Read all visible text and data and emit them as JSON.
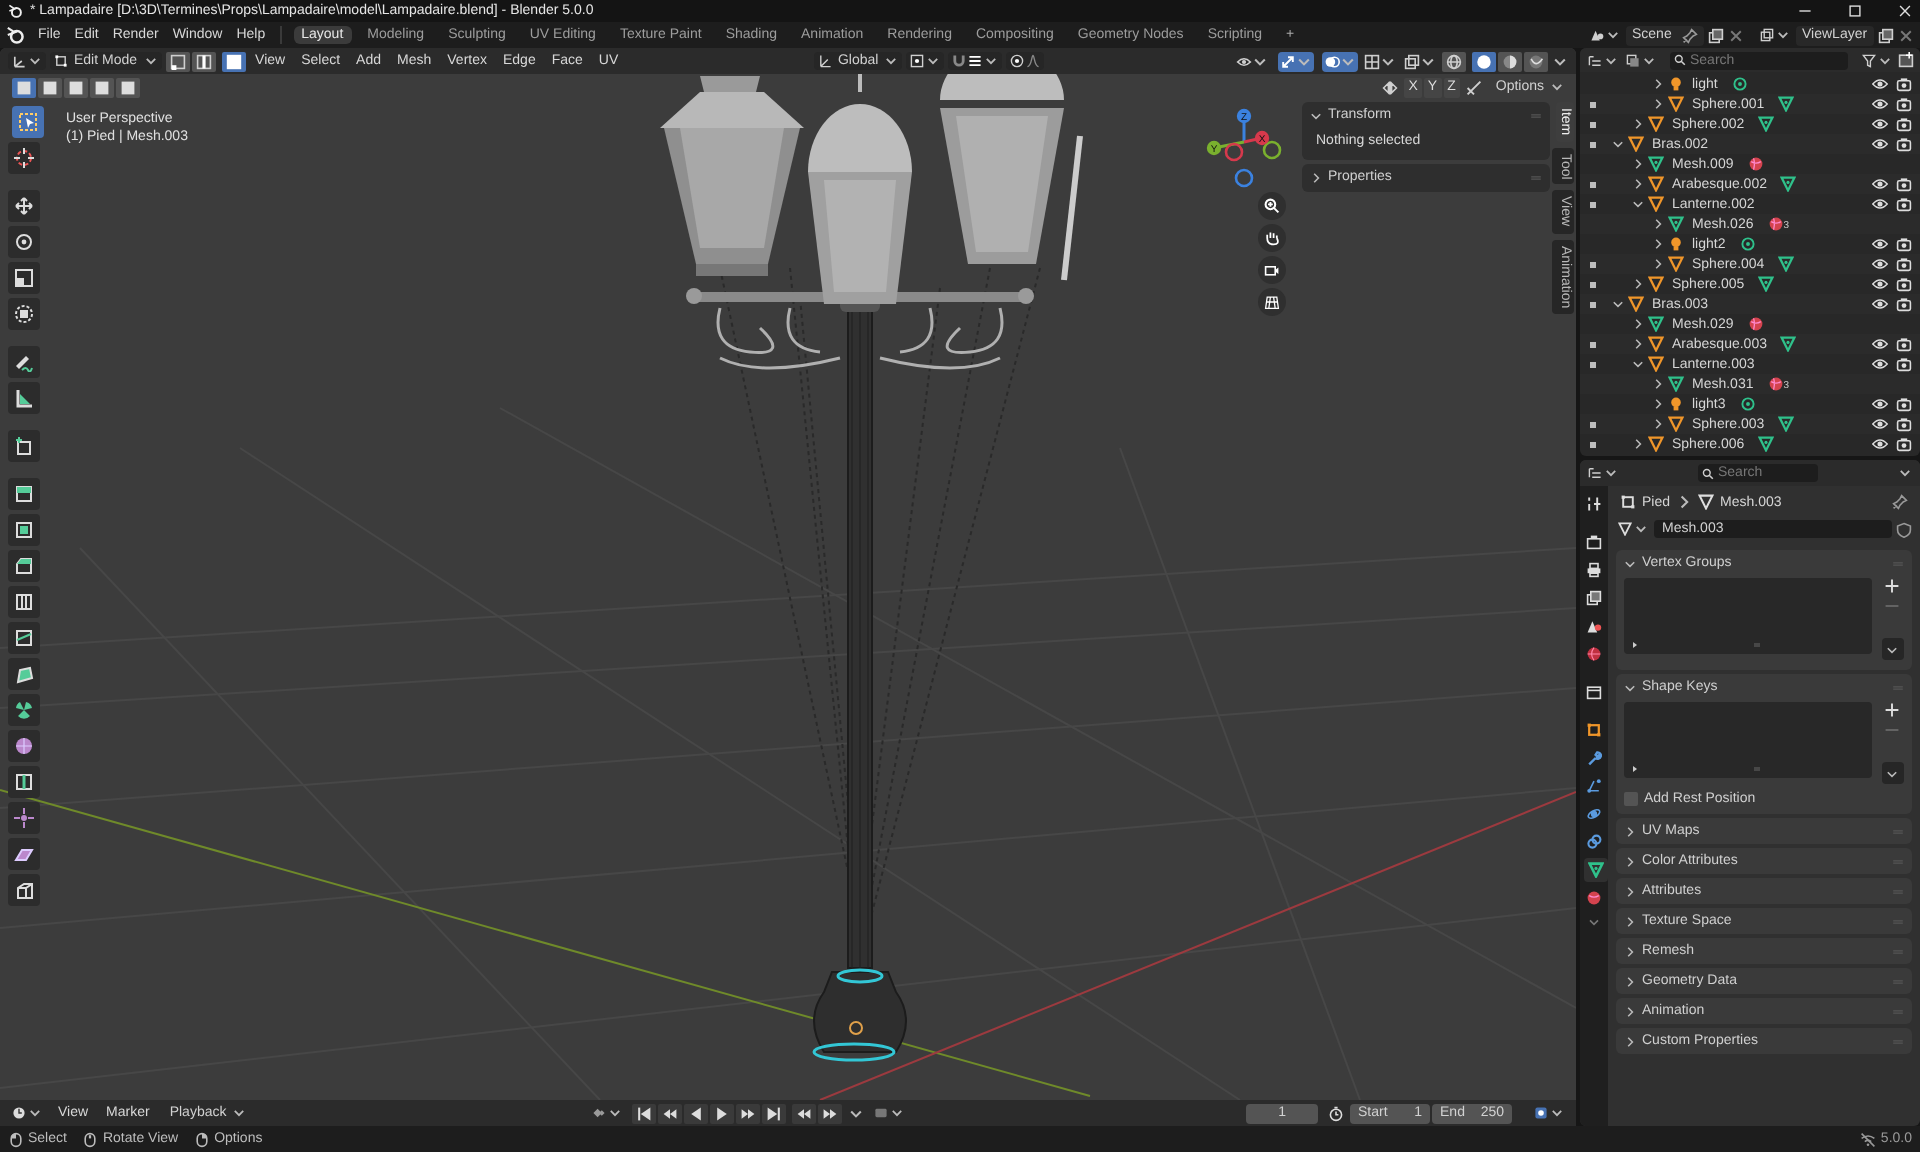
{
  "window": {
    "title": "* Lampadaire [D:\\3D\\Termines\\Props\\Lampadaire\\model\\Lampadaire.blend] - Blender 5.0.0"
  },
  "menu": [
    "File",
    "Edit",
    "Render",
    "Window",
    "Help"
  ],
  "workspaces": [
    {
      "label": "Layout",
      "selected": true
    },
    {
      "label": "Modeling",
      "selected": false
    },
    {
      "label": "Sculpting",
      "selected": false
    },
    {
      "label": "UV Editing",
      "selected": false
    },
    {
      "label": "Texture Paint",
      "selected": false
    },
    {
      "label": "Shading",
      "selected": false
    },
    {
      "label": "Animation",
      "selected": false
    },
    {
      "label": "Rendering",
      "selected": false
    },
    {
      "label": "Compositing",
      "selected": false
    },
    {
      "label": "Geometry Nodes",
      "selected": false
    },
    {
      "label": "Scripting",
      "selected": false
    }
  ],
  "add_workspace": "+",
  "scene": "Scene",
  "view_layer": "ViewLayer",
  "viewport": {
    "mode": "Edit Mode",
    "select_modes": [
      {
        "kind": "vertex",
        "selected": false
      },
      {
        "kind": "edge",
        "selected": false
      },
      {
        "kind": "face",
        "selected": true
      }
    ],
    "menus": [
      "View",
      "Select",
      "Add",
      "Mesh",
      "Vertex",
      "Edge",
      "Face",
      "UV"
    ],
    "orientation": "Global",
    "toggles": [
      {
        "kind": "visibility",
        "on": false
      },
      {
        "kind": "gizmo",
        "on": true
      },
      {
        "kind": "overlay",
        "on": true
      },
      {
        "kind": "mesh-overlay",
        "on": false
      },
      {
        "kind": "xray",
        "on": false
      }
    ],
    "shading": [
      {
        "kind": "wireframe",
        "selected": false
      },
      {
        "kind": "solid",
        "selected": true
      },
      {
        "kind": "material",
        "selected": false
      },
      {
        "kind": "rendered",
        "selected": false
      }
    ],
    "selection_ops": [
      {
        "selected": true
      },
      {
        "selected": false
      },
      {
        "selected": false
      },
      {
        "selected": false
      },
      {
        "selected": false
      }
    ],
    "mirror_axes": [
      {
        "label": "X",
        "on": false
      },
      {
        "label": "Y",
        "on": false
      },
      {
        "label": "Z",
        "on": false
      }
    ],
    "options": "Options",
    "view_name": "User Perspective",
    "object_info": "(1) Pied | Mesh.003",
    "gizmo_axes": [
      "Z",
      "Y",
      "X"
    ],
    "tools": [
      {
        "kind": "select-box",
        "selected": true
      },
      {
        "kind": "cursor",
        "selected": false
      },
      {
        "kind": "move",
        "selected": false
      },
      {
        "kind": "rotate",
        "selected": false
      },
      {
        "kind": "scale",
        "selected": false
      },
      {
        "kind": "transform",
        "selected": false
      },
      {
        "kind": "annotate",
        "selected": false
      },
      {
        "kind": "measure",
        "selected": false
      },
      {
        "kind": "add-cube",
        "selected": false
      },
      {
        "kind": "extrude",
        "selected": false
      },
      {
        "kind": "inset",
        "selected": false
      },
      {
        "kind": "bevel",
        "selected": false
      },
      {
        "kind": "loop-cut",
        "selected": false
      },
      {
        "kind": "knife",
        "selected": false
      },
      {
        "kind": "poly-build",
        "selected": false
      },
      {
        "kind": "spin",
        "selected": false
      },
      {
        "kind": "smooth",
        "selected": false
      },
      {
        "kind": "edge-slide",
        "selected": false
      },
      {
        "kind": "shrink",
        "selected": false
      },
      {
        "kind": "shear",
        "selected": false
      },
      {
        "kind": "rip",
        "selected": false
      }
    ],
    "sidebar": {
      "tabs": [
        {
          "label": "Item",
          "selected": true
        },
        {
          "label": "Tool",
          "selected": false
        },
        {
          "label": "View",
          "selected": false
        },
        {
          "label": "Animation",
          "selected": false
        }
      ],
      "panels": [
        {
          "title": "Transform",
          "expanded": true,
          "text": "Nothing selected"
        },
        {
          "title": "Properties",
          "expanded": false
        }
      ]
    }
  },
  "outliner": {
    "search": {
      "placeholder": "Search"
    },
    "items": [
      {
        "children": [
          {
            "children": [
              {
                "name": "light",
                "kind": "light",
                "expanded": false,
                "badge": {
                  "kind": "light-data"
                }
              },
              {
                "name": "Sphere.001",
                "kind": "object",
                "expanded": false,
                "badge": {
                  "kind": "mesh"
                }
              }
            ]
          },
          {
            "name": "Sphere.002",
            "kind": "object",
            "expanded": false,
            "badge": {
              "kind": "mesh"
            }
          }
        ]
      },
      {
        "name": "Bras.002",
        "kind": "object",
        "expanded": true,
        "children": [
          {
            "name": "Mesh.009",
            "kind": "mesh",
            "expanded": false,
            "badge": {
              "kind": "material"
            }
          },
          {
            "name": "Arabesque.002",
            "kind": "object",
            "expanded": false,
            "badge": {
              "kind": "mesh"
            }
          },
          {
            "name": "Lanterne.002",
            "kind": "object",
            "expanded": true,
            "children": [
              {
                "name": "Mesh.026",
                "kind": "mesh",
                "expanded": false,
                "badge": {
                  "kind": "material",
                  "count": "3"
                }
              },
              {
                "name": "light2",
                "kind": "light",
                "expanded": false,
                "badge": {
                  "kind": "light-data"
                }
              },
              {
                "name": "Sphere.004",
                "kind": "object",
                "expanded": false,
                "badge": {
                  "kind": "mesh"
                }
              }
            ]
          },
          {
            "name": "Sphere.005",
            "kind": "object",
            "expanded": false,
            "badge": {
              "kind": "mesh"
            }
          }
        ]
      },
      {
        "name": "Bras.003",
        "kind": "object",
        "expanded": true,
        "children": [
          {
            "name": "Mesh.029",
            "kind": "mesh",
            "expanded": false,
            "badge": {
              "kind": "material"
            }
          },
          {
            "name": "Arabesque.003",
            "kind": "object",
            "expanded": false,
            "badge": {
              "kind": "mesh"
            }
          },
          {
            "name": "Lanterne.003",
            "kind": "object",
            "expanded": true,
            "children": [
              {
                "name": "Mesh.031",
                "kind": "mesh",
                "expanded": false,
                "badge": {
                  "kind": "material",
                  "count": "3"
                }
              },
              {
                "name": "light3",
                "kind": "light",
                "expanded": false,
                "badge": {
                  "kind": "light-data"
                }
              },
              {
                "name": "Sphere.003",
                "kind": "object",
                "expanded": false,
                "badge": {
                  "kind": "mesh"
                }
              }
            ]
          },
          {
            "name": "Sphere.006",
            "kind": "object",
            "expanded": false,
            "badge": {
              "kind": "mesh"
            }
          }
        ]
      }
    ]
  },
  "properties": {
    "search": {
      "placeholder": "Search"
    },
    "tabs": [
      {
        "kind": "tool",
        "selected": false
      },
      {
        "kind": "render",
        "selected": false
      },
      {
        "kind": "output",
        "selected": false
      },
      {
        "kind": "view-layer",
        "selected": false
      },
      {
        "kind": "scene",
        "selected": false
      },
      {
        "kind": "world",
        "selected": false
      },
      {
        "kind": "collection",
        "selected": false
      },
      {
        "kind": "object",
        "selected": false
      },
      {
        "kind": "modifiers",
        "selected": false
      },
      {
        "kind": "particles",
        "selected": false
      },
      {
        "kind": "physics",
        "selected": false
      },
      {
        "kind": "constraints",
        "selected": false
      },
      {
        "kind": "data",
        "selected": true
      },
      {
        "kind": "material",
        "selected": false
      }
    ],
    "breadcrumb": [
      "Pied",
      "Mesh.003"
    ],
    "datablock": "Mesh.003",
    "panels": [
      {
        "title": "Vertex Groups",
        "expanded": true,
        "kind": "list"
      },
      {
        "title": "Shape Keys",
        "expanded": true,
        "kind": "list",
        "checkbox": {
          "label": "Add Rest Position",
          "checked": false
        }
      },
      {
        "title": "UV Maps",
        "expanded": false
      },
      {
        "title": "Color Attributes",
        "expanded": false
      },
      {
        "title": "Attributes",
        "expanded": false
      },
      {
        "title": "Texture Space",
        "expanded": false
      },
      {
        "title": "Remesh",
        "expanded": false
      },
      {
        "title": "Geometry Data",
        "expanded": false
      },
      {
        "title": "Animation",
        "expanded": false
      },
      {
        "title": "Custom Properties",
        "expanded": false
      }
    ]
  },
  "timeline": {
    "menus": [
      {
        "label": "View",
        "kind": "menu"
      },
      {
        "label": "Marker",
        "kind": "menu"
      },
      {
        "label": "Playback",
        "kind": "dropdown"
      }
    ],
    "current_frame": "1",
    "start_label": "Start",
    "start": "1",
    "end_label": "End",
    "end": "250"
  },
  "status_bar": {
    "hints": [
      {
        "label": "Select",
        "kind": "left"
      },
      {
        "label": "Rotate View",
        "kind": "middle"
      },
      {
        "label": "Options",
        "kind": "right"
      }
    ],
    "version": "5.0.0"
  }
}
